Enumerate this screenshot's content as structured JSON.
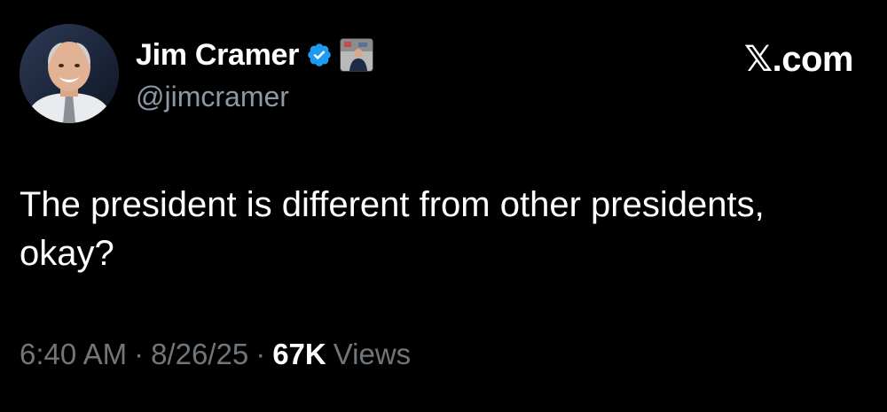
{
  "tweet": {
    "author": {
      "display_name": "Jim Cramer",
      "handle": "@jimcramer",
      "verified": true,
      "verified_color": "#1d9bf0",
      "avatar": "profile-photo",
      "affiliate_badge": "affiliate-badge-image"
    },
    "brand": "𝕏.com",
    "text": "The president is different from other presidents, okay?",
    "meta": {
      "time": "6:40 AM",
      "separator": "·",
      "date": "8/26/25",
      "views_count": "67K",
      "views_label": "Views"
    }
  },
  "colors": {
    "background": "#000000",
    "primary_text": "#ffffff",
    "secondary_text": "#71767b",
    "accent": "#1d9bf0"
  }
}
